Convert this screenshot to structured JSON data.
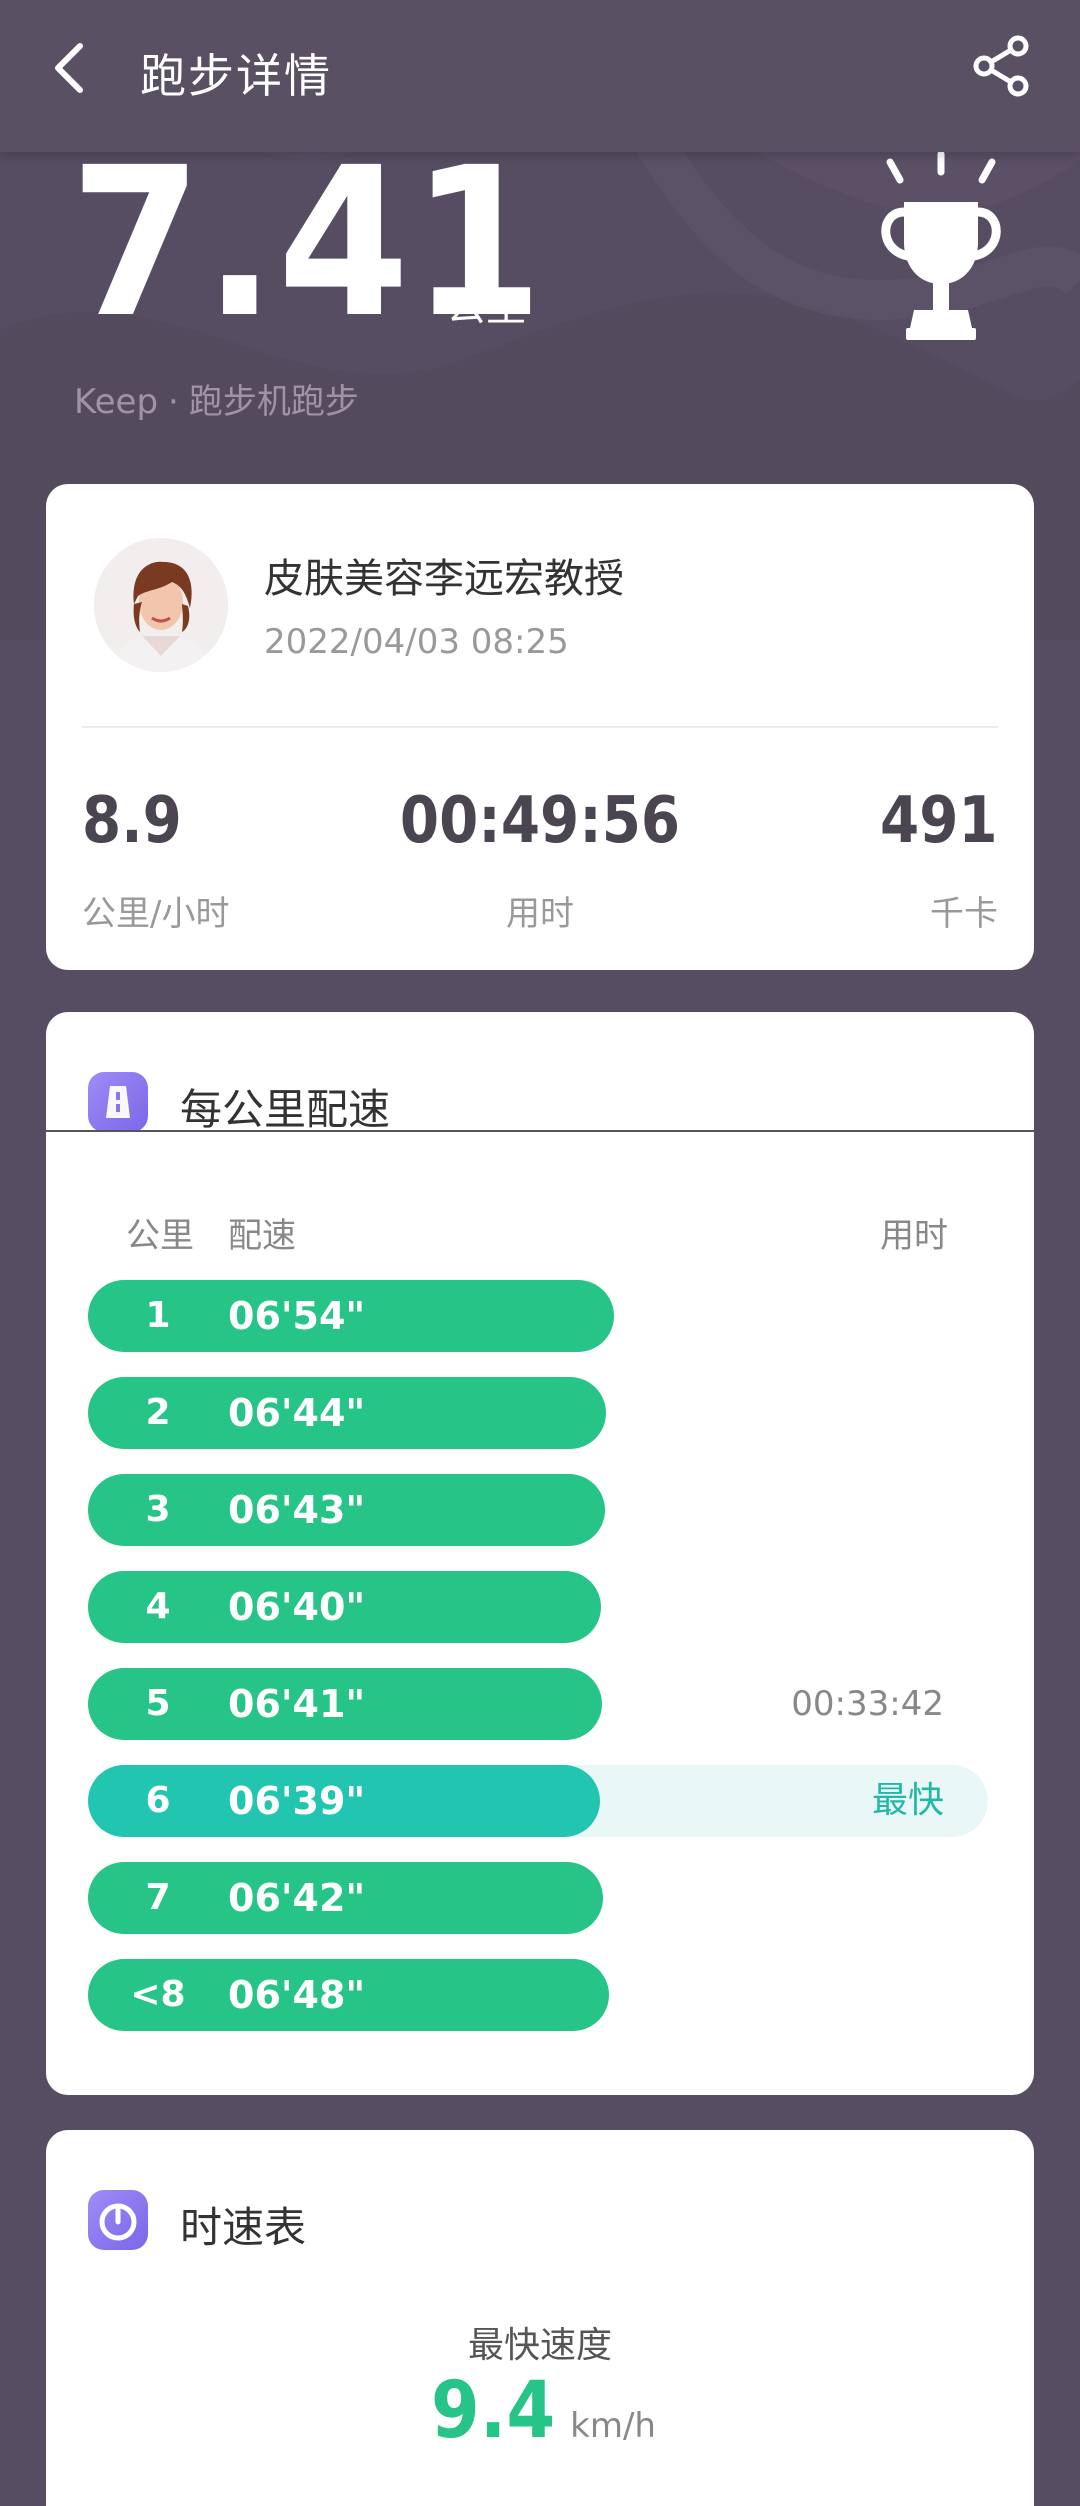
{
  "header": {
    "title": "跑步详情"
  },
  "hero": {
    "distance": "7.41",
    "unit": "公里",
    "source_app": "Keep",
    "source_sep": "·",
    "source_type": "跑步机跑步"
  },
  "user": {
    "name": "皮肤美容李远宏教授",
    "datetime": "2022/04/03 08:25"
  },
  "stats": [
    {
      "value": "8.9",
      "label": "公里/小时"
    },
    {
      "value": "00:49:56",
      "label": "用时"
    },
    {
      "value": "491",
      "label": "千卡"
    }
  ],
  "pace_section": {
    "title": "每公里配速",
    "col_km": "公里",
    "col_pace": "配速",
    "col_time": "用时",
    "rows": [
      {
        "km": "1",
        "pace": "06'54\"",
        "fraction": 1.0,
        "time": "",
        "tag": ""
      },
      {
        "km": "2",
        "pace": "06'44\"",
        "fraction": 0.985,
        "time": "",
        "tag": ""
      },
      {
        "km": "3",
        "pace": "06'43\"",
        "fraction": 0.982,
        "time": "",
        "tag": ""
      },
      {
        "km": "4",
        "pace": "06'40\"",
        "fraction": 0.976,
        "time": "",
        "tag": ""
      },
      {
        "km": "5",
        "pace": "06'41\"",
        "fraction": 0.978,
        "time": "00:33:42",
        "tag": ""
      },
      {
        "km": "6",
        "pace": "06'39\"",
        "fraction": 0.974,
        "time": "",
        "tag": "最快",
        "best": true
      },
      {
        "km": "7",
        "pace": "06'42\"",
        "fraction": 0.98,
        "time": "",
        "tag": ""
      },
      {
        "km": "<8",
        "pace": "06'48\"",
        "fraction": 0.99,
        "time": "",
        "tag": ""
      }
    ]
  },
  "speed_section": {
    "title": "时速表",
    "max_label": "最快速度",
    "max_value": "9.4",
    "max_unit": "km/h"
  },
  "colors": {
    "bar": "#26c487",
    "best_bar": "#22c5b0",
    "background": "#574d62"
  }
}
